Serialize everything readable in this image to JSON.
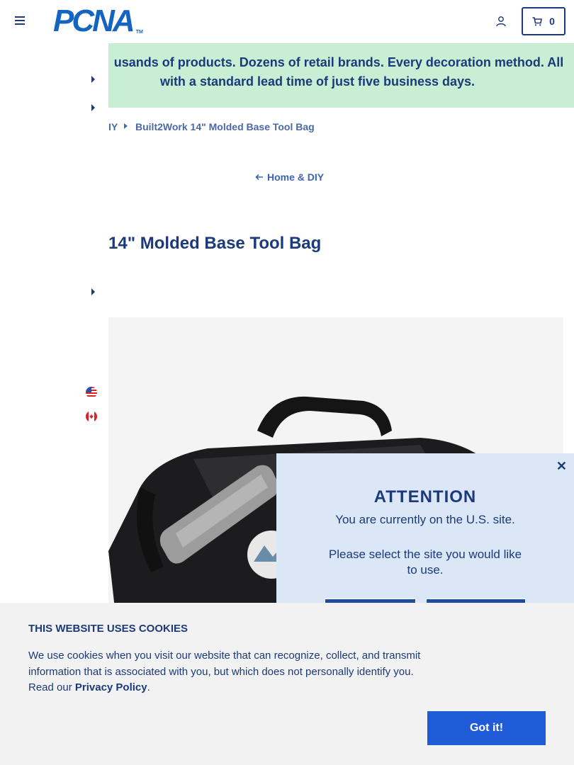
{
  "header": {
    "logo_text": "PCNA",
    "logo_tm": "TM",
    "cart_count": "0"
  },
  "banner": {
    "text": "Thousands of products. Dozens of retail brands. Every decoration method. All with a standard lead time of just five business days.",
    "line1": "usands of products. Dozens of retail brands. Every decoration method. All",
    "line2": "with a standard lead time of just five business days."
  },
  "breadcrumb": {
    "parent_visible": "IY",
    "current": "Built2Work 14\" Molded Base Tool Bag"
  },
  "back_link": {
    "label": "Home & DIY"
  },
  "product": {
    "title_visible": "14\" Molded Base Tool Bag"
  },
  "attention": {
    "heading": "ATTENTION",
    "message": "You are currently on the U.S. site.",
    "prompt": "Please select the site you would like to use."
  },
  "cookie": {
    "heading": "THIS WEBSITE USES COOKIES",
    "body": "We use cookies when you visit our website that can recognize, collect, and transmit information that is associated with you, but which does not personally identify you. Read our ",
    "link": "Privacy Policy",
    "period": ".",
    "button": "Got it!"
  },
  "colors": {
    "navy": "#1b3a7a",
    "brand_blue": "#1565c0",
    "banner_green": "#c8efd4",
    "modal_bg": "#dbe7f6",
    "cookie_button": "#1e5bd6"
  }
}
